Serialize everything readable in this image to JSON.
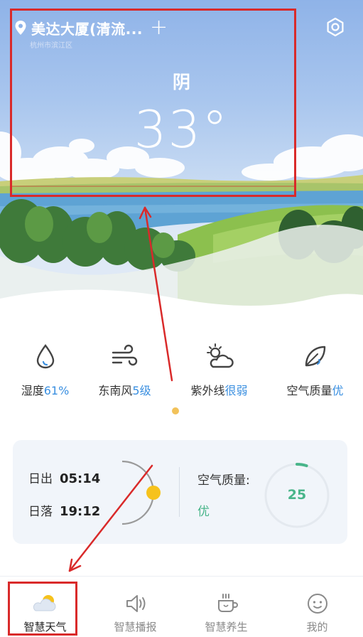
{
  "location": {
    "name": "美达大厦(清流...",
    "sub": "杭州市滨江区",
    "add_label": "+"
  },
  "weather": {
    "condition": "阴",
    "temperature": "33°"
  },
  "metrics": [
    {
      "label": "湿度",
      "value": "61%",
      "icon": "humidity-drop-icon"
    },
    {
      "label": "东南风",
      "value": "5级",
      "icon": "wind-icon"
    },
    {
      "label": "紫外线",
      "value": "很弱",
      "icon": "sun-cloud-icon"
    },
    {
      "label": "空气质量",
      "value": "优",
      "icon": "leaf-icon"
    }
  ],
  "sun": {
    "sunrise_label": "日出",
    "sunrise": "05:14",
    "sunset_label": "日落",
    "sunset": "19:12"
  },
  "air": {
    "title": "空气质量:",
    "level": "优",
    "value": "25",
    "value_fraction": 0.05
  },
  "nav": {
    "tabs": [
      {
        "label": "智慧天气",
        "icon": "weather-icon",
        "active": true
      },
      {
        "label": "智慧播报",
        "icon": "speaker-icon",
        "active": false
      },
      {
        "label": "智慧养生",
        "icon": "tea-cup-icon",
        "active": false
      },
      {
        "label": "我的",
        "icon": "smiley-icon",
        "active": false
      }
    ]
  },
  "colors": {
    "accent_blue": "#3a8fe0",
    "air_green": "#49b58a",
    "highlight_red": "#d92a2a",
    "sun_yellow": "#f6c21c"
  }
}
